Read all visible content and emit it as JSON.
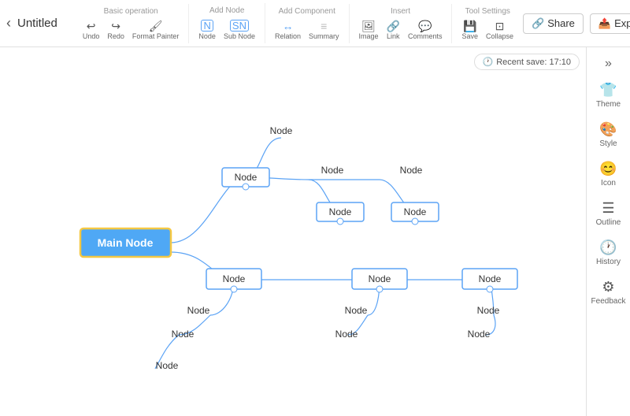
{
  "header": {
    "back_label": "‹",
    "title": "Untitled",
    "toolbar": {
      "groups": [
        {
          "label": "Basic operation",
          "items": [
            {
              "id": "undo",
              "icon": "↩",
              "label": "Undo"
            },
            {
              "id": "redo",
              "icon": "↪",
              "label": "Redo"
            },
            {
              "id": "format-painter",
              "icon": "🖌",
              "label": "Format Painter"
            }
          ]
        },
        {
          "label": "Add Node",
          "items": [
            {
              "id": "node",
              "icon": "⬜",
              "label": "Node"
            },
            {
              "id": "sub-node",
              "icon": "⬜",
              "label": "Sub Node"
            }
          ]
        },
        {
          "label": "Add Component",
          "items": [
            {
              "id": "relation",
              "icon": "↔",
              "label": "Relation"
            },
            {
              "id": "summary",
              "icon": "≡",
              "label": "Summary"
            }
          ]
        },
        {
          "label": "Insert",
          "items": [
            {
              "id": "image",
              "icon": "🖼",
              "label": "Image"
            },
            {
              "id": "link",
              "icon": "🔗",
              "label": "Link"
            },
            {
              "id": "comments",
              "icon": "💬",
              "label": "Comments"
            }
          ]
        },
        {
          "label": "Tool Settings",
          "items": [
            {
              "id": "save",
              "icon": "💾",
              "label": "Save"
            },
            {
              "id": "collapse",
              "icon": "⊡",
              "label": "Collapse"
            }
          ]
        }
      ]
    },
    "share_label": "Share",
    "export_label": "Export"
  },
  "recent_save": "Recent save: 17:10",
  "sidebar": {
    "collapse_icon": "»",
    "items": [
      {
        "id": "theme",
        "icon": "👕",
        "label": "Theme"
      },
      {
        "id": "style",
        "icon": "🎨",
        "label": "Style"
      },
      {
        "id": "icon",
        "icon": "😊",
        "label": "Icon"
      },
      {
        "id": "outline",
        "icon": "☰",
        "label": "Outline"
      },
      {
        "id": "history",
        "icon": "🕐",
        "label": "History"
      },
      {
        "id": "feedback",
        "icon": "⚙",
        "label": "Feedback"
      }
    ]
  },
  "mindmap": {
    "main_node": "Main Node",
    "nodes": [
      "Node",
      "Node",
      "Node",
      "Node",
      "Node",
      "Node",
      "Node",
      "Node",
      "Node",
      "Node",
      "Node",
      "Node",
      "Node",
      "Node"
    ]
  }
}
